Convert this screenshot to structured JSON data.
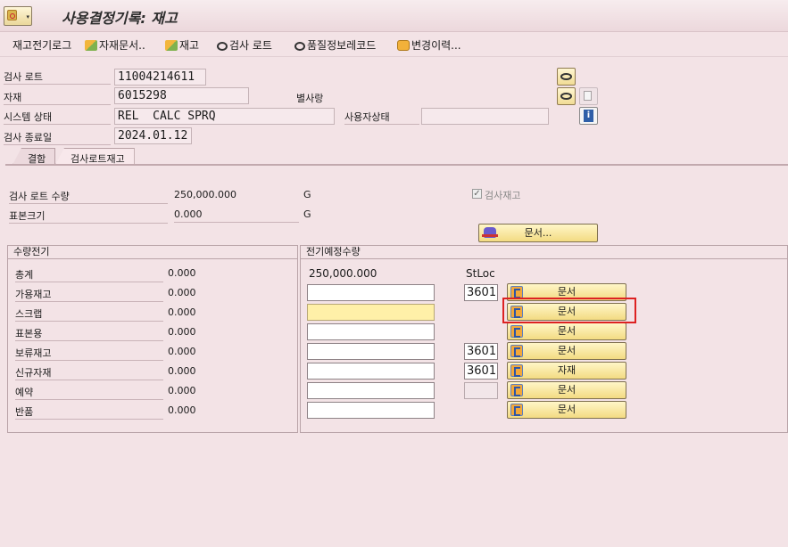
{
  "window": {
    "title": "사용결정기록: 재고"
  },
  "toolbar": [
    {
      "label": "재고전기로그",
      "icon": "none"
    },
    {
      "label": "자재문서..",
      "icon": "mountain-icon"
    },
    {
      "label": "재고",
      "icon": "mountain-icon"
    },
    {
      "label": "검사 로트",
      "icon": "glasses-icon"
    },
    {
      "label": "품질정보레코드",
      "icon": "glasses-icon"
    },
    {
      "label": "변경이력...",
      "icon": "scroll-icon"
    }
  ],
  "header": {
    "inspection_lot": {
      "label": "검사 로트",
      "value": "11004214611"
    },
    "material": {
      "label": "자재",
      "value": "6015298"
    },
    "plant_label": "별사랑",
    "system_status": {
      "label": "시스템 상태",
      "value": "REL  CALC SPRQ"
    },
    "user_status": {
      "label": "사용자상태",
      "value": ""
    },
    "inspection_end": {
      "label": "검사 종료일",
      "value": "2024.01.12"
    }
  },
  "tabs": [
    {
      "label": "결함",
      "active": false
    },
    {
      "label": "검사로트재고",
      "active": true
    }
  ],
  "lot_summary": {
    "lot_qty_label": "검사 로트 수량",
    "lot_qty_value": "250,000.000",
    "lot_qty_unit": "G",
    "sample_size_label": "표본크기",
    "sample_size_value": "0.000",
    "sample_size_unit": "G",
    "inspection_stock_label": "검사재고",
    "inspection_stock_checked": true,
    "document_button_label": "문서..."
  },
  "posting_group": {
    "title": "수량전기",
    "rows": [
      {
        "label": "총계",
        "value": "0.000"
      },
      {
        "label": "가용재고",
        "value": "0.000"
      },
      {
        "label": "스크랩",
        "value": "0.000"
      },
      {
        "label": "표본용",
        "value": "0.000"
      },
      {
        "label": "보류재고",
        "value": "0.000"
      },
      {
        "label": "신규자재",
        "value": "0.000"
      },
      {
        "label": "예약",
        "value": "0.000"
      },
      {
        "label": "반품",
        "value": "0.000"
      }
    ]
  },
  "planned_group": {
    "title": "전기예정수량",
    "total_value": "250,000.000",
    "stloc_header": "StLoc",
    "rows": [
      {
        "stloc": "3601",
        "button": "문서",
        "required": false,
        "stloc_visible": true,
        "stloc_empty": false
      },
      {
        "stloc": "",
        "button": "문서",
        "required": true,
        "stloc_visible": false,
        "stloc_empty": false
      },
      {
        "stloc": "",
        "button": "문서",
        "required": false,
        "stloc_visible": false,
        "stloc_empty": false
      },
      {
        "stloc": "3601",
        "button": "문서",
        "required": false,
        "stloc_visible": true,
        "stloc_empty": false
      },
      {
        "stloc": "3601",
        "button": "자재",
        "required": false,
        "stloc_visible": true,
        "stloc_empty": false
      },
      {
        "stloc": "",
        "button": "문서",
        "required": false,
        "stloc_visible": true,
        "stloc_empty": true
      },
      {
        "stloc": "",
        "button": "문서",
        "required": false,
        "stloc_visible": false,
        "stloc_empty": false
      }
    ]
  },
  "colors": {
    "background": "#f3e3e6",
    "button": "#f3db82",
    "highlight": "#dd2222",
    "required_field": "#fff0a8"
  }
}
